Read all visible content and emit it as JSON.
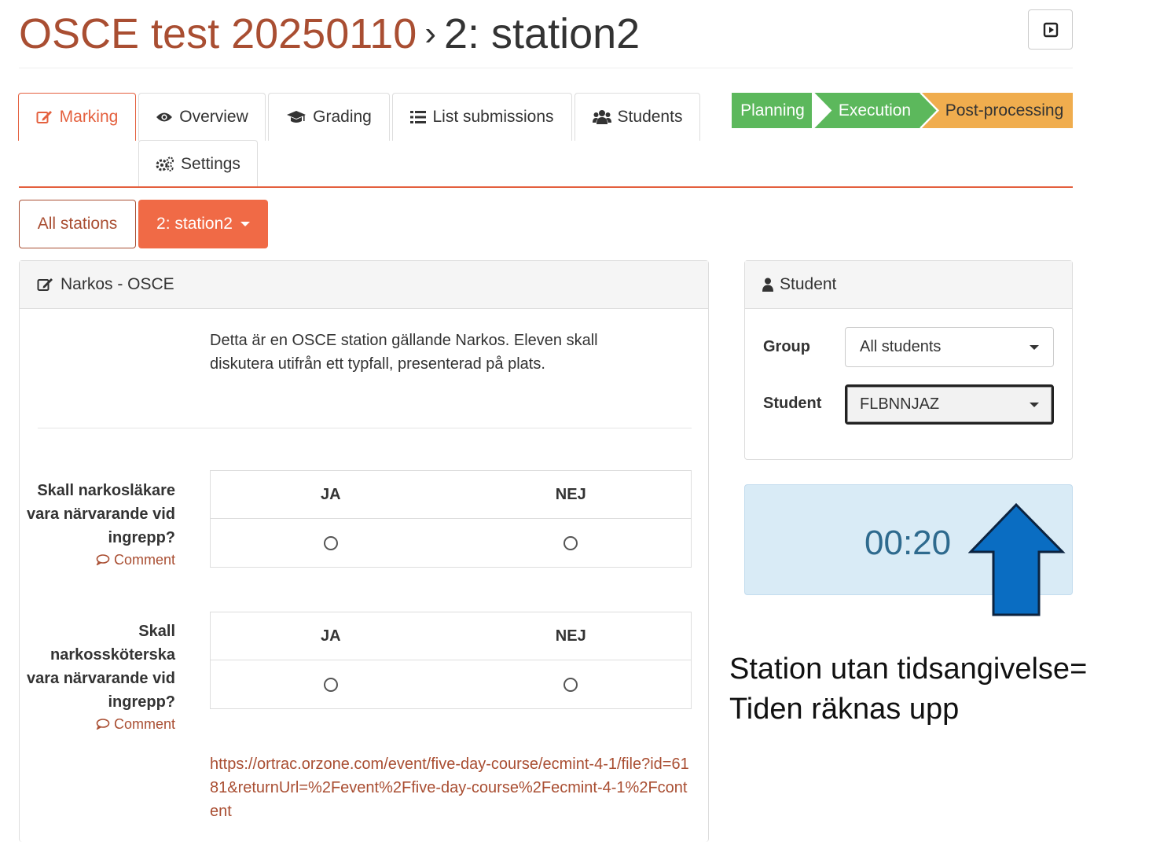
{
  "header": {
    "course_link": "OSCE test 20250110",
    "separator": "›",
    "current": "2: station2"
  },
  "tabs": {
    "marking": "Marking",
    "overview": "Overview",
    "grading": "Grading",
    "list_submissions": "List submissions",
    "students": "Students",
    "settings": "Settings"
  },
  "workflow": {
    "steps": [
      "Planning",
      "Execution",
      "Post-processing"
    ],
    "colors": {
      "planning": "#5cb85c",
      "execution": "#5cb85c",
      "post_processing": "#f0ad4e"
    }
  },
  "stations": {
    "all_label": "All stations",
    "current_label": "2: station2"
  },
  "assessment": {
    "title": "Narkos - OSCE",
    "description": "Detta är en OSCE station gällande Narkos. Eleven skall diskutera utifrån ett typfall, presenterad på plats.",
    "questions": [
      {
        "text": "Skall narkosläkare vara närvarande vid ingrepp?",
        "comment": "Comment",
        "options": [
          "JA",
          "NEJ"
        ]
      },
      {
        "text": "Skall narkossköterska vara närvarande vid ingrepp?",
        "comment": "Comment",
        "options": [
          "JA",
          "NEJ"
        ]
      }
    ],
    "link": "https://ortrac.orzone.com/event/five-day-course/ecmint-4-1/file?id=6181&returnUrl=%2Fevent%2Ffive-day-course%2Fecmint-4-1%2Fcontent"
  },
  "student_panel": {
    "title": "Student",
    "group_label": "Group",
    "group_value": "All students",
    "student_label": "Student",
    "student_value": "FLBNNJAZ"
  },
  "timer": {
    "value": "00:20"
  },
  "annotation": {
    "line1": "Station utan tidsangivelse=",
    "line2": "Tiden räknas upp",
    "arrow_color": "#0a6dc2"
  }
}
